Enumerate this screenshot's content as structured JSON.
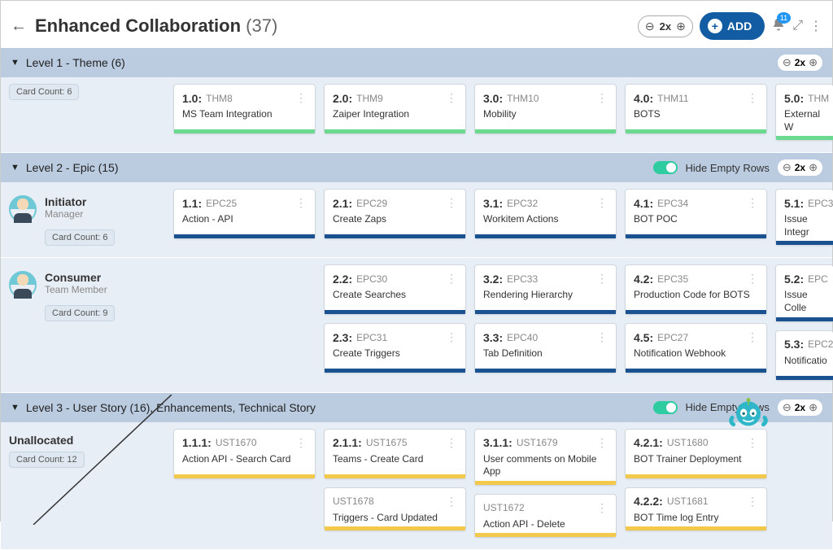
{
  "header": {
    "title": "Enhanced Collaboration",
    "count": "(37)",
    "zoom": "2x",
    "add_label": "ADD",
    "notif_count": "11"
  },
  "levels": [
    {
      "label": "Level 1  -  Theme (6)",
      "side": {
        "card_count": "Card Count: 6"
      },
      "hide_rows": false,
      "rows": [
        {
          "role": null,
          "cols": [
            [
              {
                "num": "1.0:",
                "id": "THM8",
                "title": "MS Team Integration",
                "bar": "green"
              }
            ],
            [
              {
                "num": "2.0:",
                "id": "THM9",
                "title": "Zaiper Integration",
                "bar": "green"
              }
            ],
            [
              {
                "num": "3.0:",
                "id": "THM10",
                "title": "Mobility",
                "bar": "green"
              }
            ],
            [
              {
                "num": "4.0:",
                "id": "THM11",
                "title": "BOTS",
                "bar": "green"
              }
            ],
            [
              {
                "num": "5.0:",
                "id": "THM",
                "title": "External W",
                "bar": "green",
                "clip": true
              }
            ]
          ]
        }
      ]
    },
    {
      "label": "Level 2  -  Epic (15)",
      "hide_rows": true,
      "hide_label": "Hide Empty Rows",
      "rows": [
        {
          "role": {
            "name": "Initiator",
            "sub": "Manager",
            "count": "Card Count: 6"
          },
          "cols": [
            [
              {
                "num": "1.1:",
                "id": "EPC25",
                "title": "Action - API",
                "bar": "blue"
              }
            ],
            [
              {
                "num": "2.1:",
                "id": "EPC29",
                "title": "Create Zaps",
                "bar": "blue"
              }
            ],
            [
              {
                "num": "3.1:",
                "id": "EPC32",
                "title": "Workitem Actions",
                "bar": "blue"
              }
            ],
            [
              {
                "num": "4.1:",
                "id": "EPC34",
                "title": "BOT POC",
                "bar": "blue"
              }
            ],
            [
              {
                "num": "5.1:",
                "id": "EPC3",
                "title": "Issue Integr",
                "bar": "blue",
                "clip": true
              }
            ]
          ]
        },
        {
          "role": {
            "name": "Consumer",
            "sub": "Team Member",
            "count": "Card Count: 9"
          },
          "cols": [
            [],
            [
              {
                "num": "2.2:",
                "id": "EPC30",
                "title": "Create Searches",
                "bar": "blue"
              },
              {
                "num": "2.3:",
                "id": "EPC31",
                "title": "Create Triggers",
                "bar": "blue"
              }
            ],
            [
              {
                "num": "3.2:",
                "id": "EPC33",
                "title": "Rendering Hierarchy",
                "bar": "blue"
              },
              {
                "num": "3.3:",
                "id": "EPC40",
                "title": "Tab Definition",
                "bar": "blue"
              }
            ],
            [
              {
                "num": "4.2:",
                "id": "EPC35",
                "title": "Production Code for BOTS",
                "bar": "blue"
              },
              {
                "num": "4.5:",
                "id": "EPC27",
                "title": "Notification Webhook",
                "bar": "blue"
              }
            ],
            [
              {
                "num": "5.2:",
                "id": "EPC",
                "title": "Issue Colle",
                "bar": "blue",
                "clip": true
              },
              {
                "num": "5.3:",
                "id": "EPC2",
                "title": "Notificatio",
                "bar": "blue",
                "clip": true
              }
            ]
          ]
        }
      ]
    },
    {
      "label": "Level 3  -  User Story (16), Enhancements, Technical Story",
      "hide_rows": true,
      "hide_label": "Hide Empty Rows",
      "rows": [
        {
          "role_text": "Unallocated",
          "count": "Card Count: 12",
          "cols": [
            [
              {
                "num": "1.1.1:",
                "id": "UST1670",
                "title": "Action API - Search Card",
                "bar": "yellow"
              }
            ],
            [
              {
                "num": "2.1.1:",
                "id": "UST1675",
                "title": "Teams - Create Card",
                "bar": "yellow"
              },
              {
                "num": "",
                "id": "UST1678",
                "title": "Triggers - Card Updated",
                "bar": "yellow",
                "partial": true
              }
            ],
            [
              {
                "num": "3.1.1:",
                "id": "UST1679",
                "title": "User comments on Mobile App",
                "bar": "yellow"
              },
              {
                "num": "",
                "id": "UST1672",
                "title": "Action API - Delete",
                "bar": "yellow",
                "partial": true
              }
            ],
            [
              {
                "num": "4.2.1:",
                "id": "UST1680",
                "title": "BOT Trainer Deployment",
                "bar": "yellow"
              },
              {
                "num": "4.2.2:",
                "id": "UST1681",
                "title": "BOT Time log Entry",
                "bar": "yellow",
                "partial": true
              }
            ],
            []
          ]
        }
      ]
    }
  ],
  "zoom_small": "2x"
}
